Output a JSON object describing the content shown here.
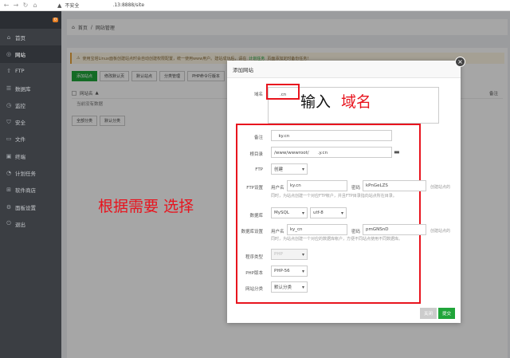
{
  "browser": {
    "security": "不安全",
    "url": ".13:8888/site"
  },
  "sidebar": {
    "badge": "0",
    "items": [
      {
        "label": "首页",
        "icon": "home-icon",
        "glyph": "⌂"
      },
      {
        "label": "网站",
        "icon": "globe-icon",
        "glyph": "◎"
      },
      {
        "label": "FTP",
        "icon": "upload-icon",
        "glyph": "⇧"
      },
      {
        "label": "数据库",
        "icon": "database-icon",
        "glyph": "☰"
      },
      {
        "label": "监控",
        "icon": "monitor-icon",
        "glyph": "◷"
      },
      {
        "label": "安全",
        "icon": "shield-icon",
        "glyph": "⛉"
      },
      {
        "label": "文件",
        "icon": "folder-icon",
        "glyph": "▭"
      },
      {
        "label": "终端",
        "icon": "terminal-icon",
        "glyph": "▣"
      },
      {
        "label": "计划任务",
        "icon": "clock-icon",
        "glyph": "◔"
      },
      {
        "label": "软件商店",
        "icon": "grid-icon",
        "glyph": "⊞"
      },
      {
        "label": "面板设置",
        "icon": "gear-icon",
        "glyph": "⚙"
      },
      {
        "label": "退出",
        "icon": "logout-icon",
        "glyph": "⏻"
      }
    ]
  },
  "breadcrumb": {
    "home": "首页",
    "sep": "/",
    "current": "网站管理"
  },
  "notice": {
    "text": "使用宝塔Linux面板创建站点时会自动创建权限配置，统一使用www用户。建站成功后，请在",
    "link": "计划任务",
    "tail": "页面添加定时备份任务!"
  },
  "toolbar": {
    "add_site": "添加站点",
    "default_page": "修改默认页",
    "default_site": "默认站点",
    "category": "分类管理",
    "php_cli": "PHP命令行版本"
  },
  "table": {
    "col_name": "网站名",
    "sort_glyph": "▲",
    "col_remark": "备注",
    "empty": "当前没有数据"
  },
  "bottom": {
    "all_category": "全部分类",
    "default_category": "默认分类"
  },
  "dialog": {
    "title": "添加网站",
    "close": "×",
    "domain_label": "域名",
    "domain_value": "　　.cn",
    "remark_label": "备注",
    "remark_value": "　ky.cn",
    "root_label": "根目录",
    "root_value": "/www/wwwroot/　　.y.cn",
    "ftp_label": "FTP",
    "ftp_value": "创建",
    "ftp_setting_label": "FTP设置",
    "username_label": "用户名",
    "ftp_user": "ky.cn",
    "password_label": "密码",
    "ftp_pass": "kPnGeLZS",
    "ftp_hint_right": "创建站点的",
    "ftp_hint": "同时，为站点创建一个对应FTP帐户，并且FTP目录指向站点所在目录。",
    "db_label": "数据库",
    "db_type": "MySQL",
    "db_charset": "utf-8",
    "db_setting_label": "数据库设置",
    "db_user": "ky_cn",
    "db_pass": "pmGNSnD",
    "db_hint_right": "创建站点的",
    "db_hint": "同时，为站点创建一个对应的数据库帐户，方便不同站点使用不同数据库。",
    "prog_label": "程序类型",
    "prog_value": "PHP",
    "php_label": "PHP版本",
    "php_value": "PHP-56",
    "cat_label": "网站分类",
    "cat_value": "默认分类",
    "cancel": "关闭",
    "submit": "提交"
  },
  "annotations": {
    "domain_hint_a": "输入",
    "domain_hint_b": "域名",
    "select_hint_a": "根据需要",
    "select_hint_b": "选择"
  },
  "colors": {
    "accent": "#20a53a",
    "annotation_red": "#e8141e"
  }
}
